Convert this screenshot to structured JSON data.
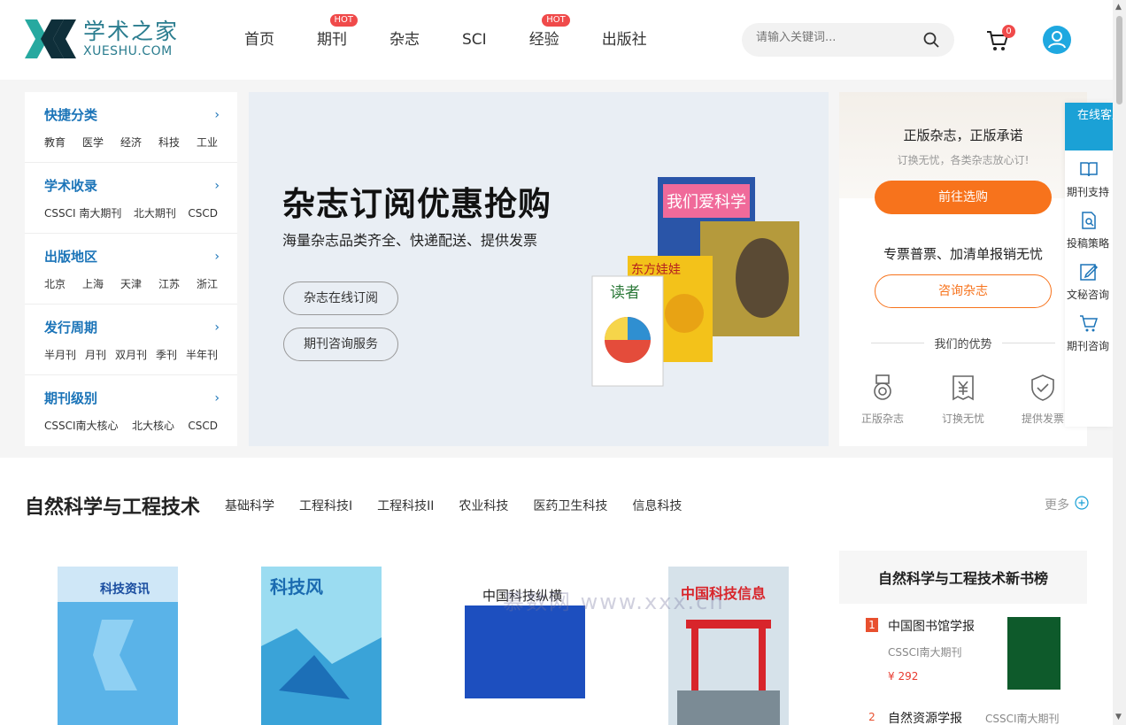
{
  "header": {
    "logo_cn": "学术之家",
    "logo_en": "XUESHU.COM",
    "nav": [
      {
        "label": "首页",
        "hot": ""
      },
      {
        "label": "期刊",
        "hot": "HOT"
      },
      {
        "label": "杂志",
        "hot": ""
      },
      {
        "label": "SCI",
        "hot": ""
      },
      {
        "label": "经验",
        "hot": "HOT"
      },
      {
        "label": "出版社",
        "hot": ""
      }
    ],
    "search_placeholder": "请输入关键词...",
    "cart_count": "0"
  },
  "categories": [
    {
      "title": "快捷分类",
      "links": [
        "教育",
        "医学",
        "经济",
        "科技",
        "工业"
      ]
    },
    {
      "title": "学术收录",
      "links": [
        "CSSCI 南大期刊",
        "北大期刊",
        "CSCD"
      ]
    },
    {
      "title": "出版地区",
      "links": [
        "北京",
        "上海",
        "天津",
        "江苏",
        "浙江"
      ]
    },
    {
      "title": "发行周期",
      "links": [
        "半月刊",
        "月刊",
        "双月刊",
        "季刊",
        "半年刊"
      ]
    },
    {
      "title": "期刊级别",
      "links": [
        "CSSCI南大核心",
        "北大核心",
        "CSCD"
      ]
    }
  ],
  "banner": {
    "title": "杂志订阅优惠抢购",
    "subtitle": "海量杂志品类齐全、快递配送、提供发票",
    "btn1": "杂志在线订阅",
    "btn2": "期刊咨询服务",
    "book_labels": [
      "我们爱科学",
      "东方娃娃",
      "读者"
    ]
  },
  "right_panel": {
    "line1": "正版杂志，正版承诺",
    "line2": "订换无忧，各类杂志放心订!",
    "btn_select": "前往选购",
    "line3": "专票普票、加清单报销无忧",
    "btn_consult": "咨询杂志",
    "adv_title": "我们的优势",
    "advantages": [
      "正版杂志",
      "订换无忧",
      "提供发票"
    ]
  },
  "service": {
    "head": "在线客服",
    "items": [
      "期刊支持",
      "投稿策略",
      "文秘咨询",
      "期刊咨询"
    ]
  },
  "section": {
    "title": "自然科学与工程技术",
    "tabs": [
      "基础科学",
      "工程科技I",
      "工程科技II",
      "农业科技",
      "医药卫生科技",
      "信息科技"
    ],
    "more": "更多",
    "covers": [
      "科技资讯",
      "科技风",
      "中国科技纵横",
      "中国科技信息"
    ],
    "rank_title": "自然科学与工程技术新书榜",
    "rank": [
      {
        "num": "1",
        "name": "中国图书馆学报",
        "tag": "CSSCI南大期刊",
        "price": "¥ 292"
      },
      {
        "num": "2",
        "name": "自然资源学报",
        "tag": "CSSCI南大期刊",
        "price": ""
      }
    ]
  },
  "watermark": "慕数网 www.xxx.cn",
  "colors": {
    "accent_blue": "#1b74b8",
    "orange": "#f7731c",
    "hot": "#f04a4a",
    "service": "#1ba1d6"
  }
}
